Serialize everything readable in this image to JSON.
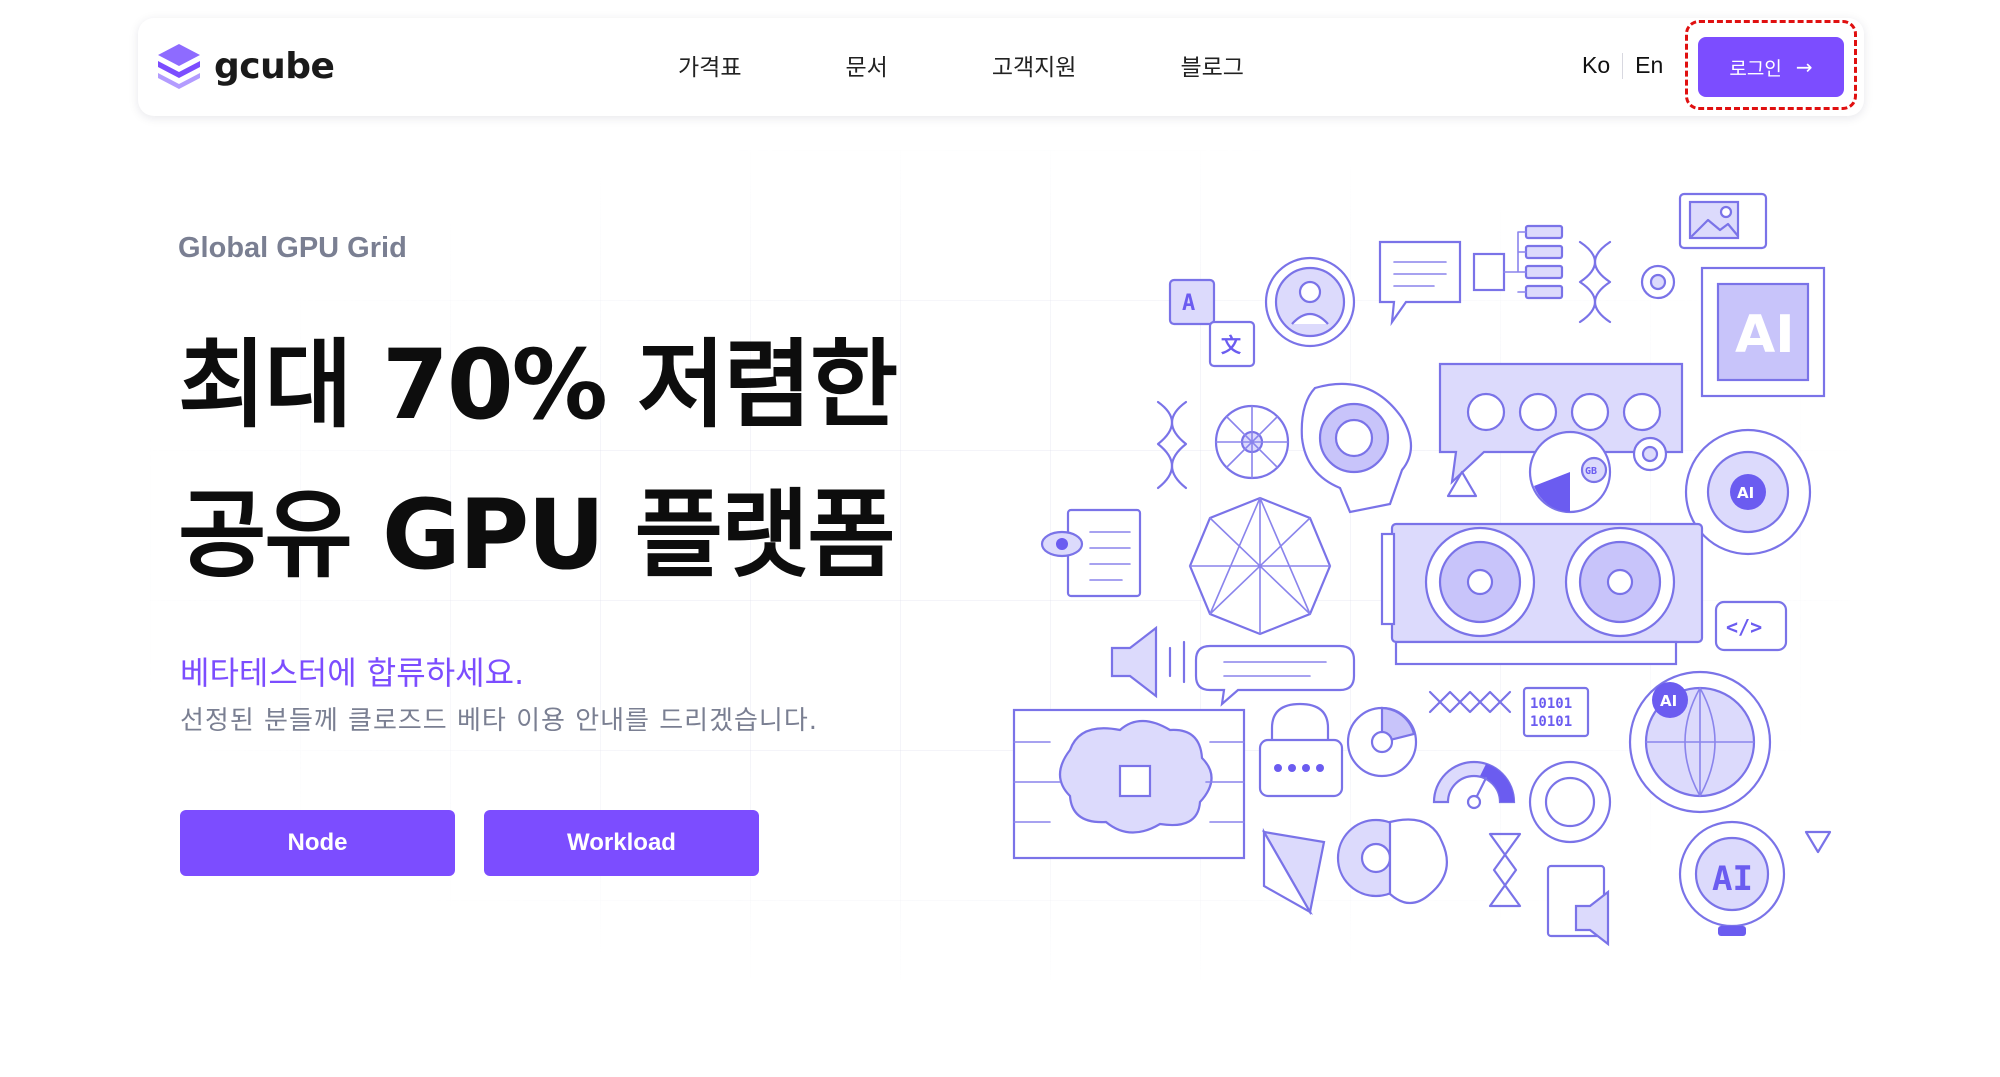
{
  "brand": {
    "name": "gcube"
  },
  "nav": {
    "items": [
      "가격표",
      "문서",
      "고객지원",
      "블로그"
    ]
  },
  "lang": {
    "ko": "Ko",
    "en": "En"
  },
  "login": {
    "label": "로그인",
    "arrow": "→"
  },
  "hero": {
    "eyebrow": "Global GPU Grid",
    "headline_line1": "최대 70% 저렴한",
    "headline_line2": "공유 GPU 플랫폼",
    "sub1": "베타테스터에 합류하세요.",
    "sub2": "선정된 분들께 클로즈드 베타 이용 안내를 드리겠습니다.",
    "cta_node": "Node",
    "cta_workload": "Workload"
  },
  "illustration": {
    "ai_badge": "AI",
    "gb_label": "GB",
    "binary_top": "10101",
    "binary_bottom": "10101",
    "translate_a": "A",
    "translate_b": "文",
    "code_tag": "</>"
  },
  "colors": {
    "accent": "#7c4dff",
    "muted_text": "#7a7f92",
    "highlight_border": "#e01010",
    "illustration_stroke": "#7a73e8"
  }
}
